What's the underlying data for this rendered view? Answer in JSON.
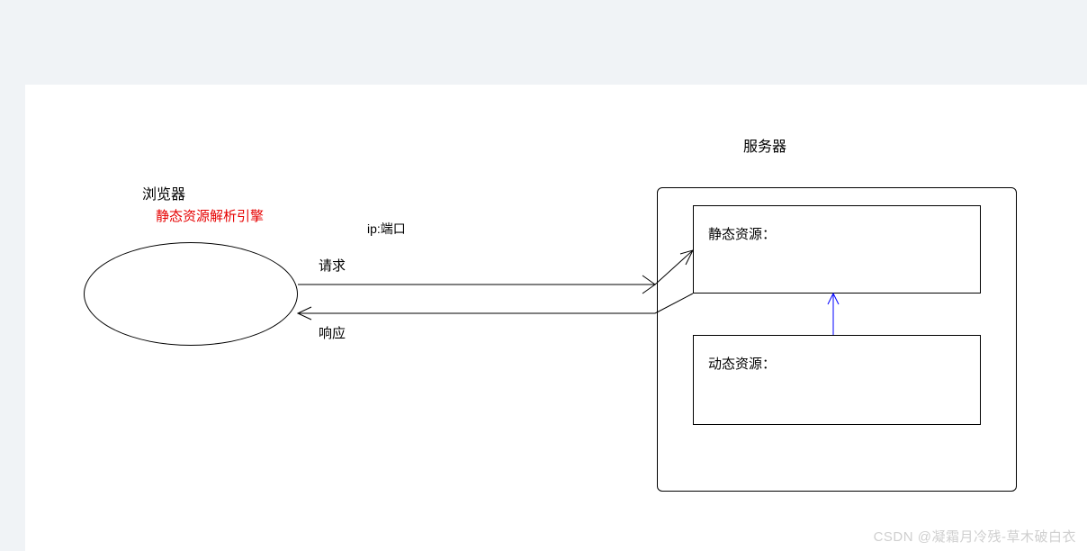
{
  "labels": {
    "browser": "浏览器",
    "engine": "静态资源解析引擎",
    "ip_port": "ip:端口",
    "request": "请求",
    "response": "响应",
    "server": "服务器",
    "static_res": "静态资源：",
    "dynamic_res": "动态资源："
  },
  "watermark": "CSDN @凝霜月冷残-草木破白衣"
}
